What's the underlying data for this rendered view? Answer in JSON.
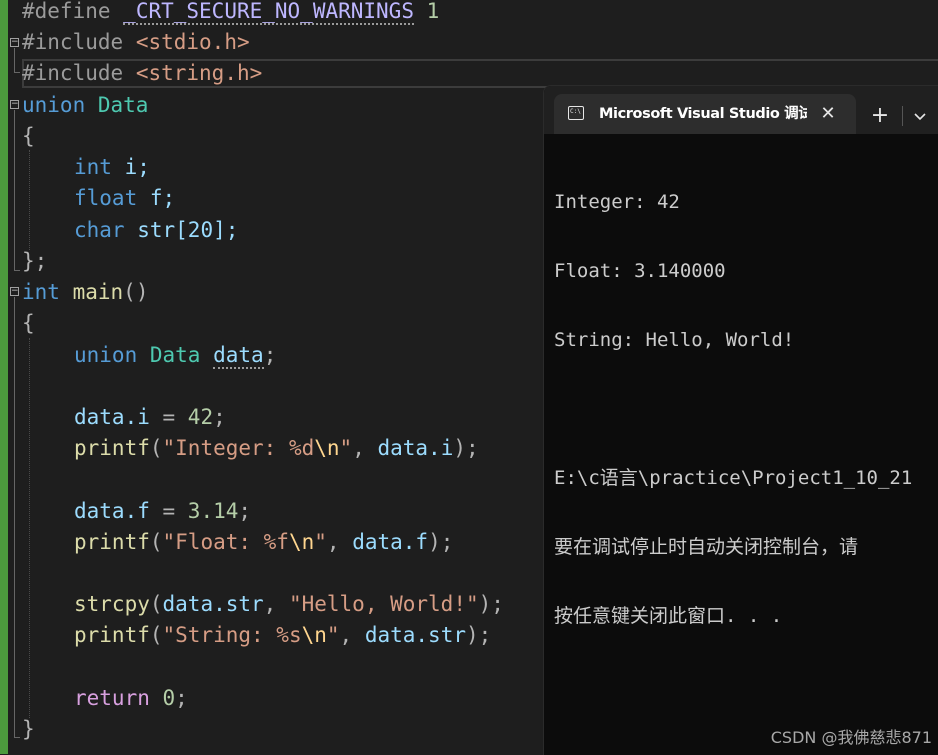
{
  "editor": {
    "lines": {
      "l1": {
        "directive": "#define",
        "macro": "_CRT_SECURE_NO_WARNINGS",
        "value": "1"
      },
      "l2": {
        "directive": "#include",
        "header": "<stdio.h>"
      },
      "l3": {
        "directive": "#include",
        "header": "<string.h>"
      },
      "l4": {
        "keyword": "union",
        "type_name": "Data"
      },
      "l5": {
        "brace": "{"
      },
      "l6": {
        "type": "int",
        "member": "i;"
      },
      "l7": {
        "type": "float",
        "member": "f;"
      },
      "l8": {
        "type": "char",
        "member": "str[20];"
      },
      "l9": {
        "brace": "};"
      },
      "l10": {
        "type": "int",
        "func": "main",
        "parens": "()"
      },
      "l11": {
        "brace": "{"
      },
      "l12": {
        "keyword": "union",
        "type_name": "Data",
        "var": "data",
        "semi": ";"
      },
      "l13": {
        "lhs": "data.i",
        "op": " = ",
        "num": "42",
        "semi": ";"
      },
      "l14": {
        "func": "printf",
        "open": "(",
        "str_a": "\"Integer: %d",
        "esc": "\\n",
        "str_b": "\"",
        "comma": ", ",
        "arg": "data.i",
        "close": ");"
      },
      "l15": {
        "lhs": "data.f",
        "op": " = ",
        "num": "3.14",
        "semi": ";"
      },
      "l16": {
        "func": "printf",
        "open": "(",
        "str_a": "\"Float: %f",
        "esc": "\\n",
        "str_b": "\"",
        "comma": ", ",
        "arg": "data.f",
        "close": ");"
      },
      "l17": {
        "func": "strcpy",
        "open": "(",
        "arg": "data.str",
        "comma": ", ",
        "str": "\"Hello, World!\"",
        "close": ");"
      },
      "l18": {
        "func": "printf",
        "open": "(",
        "str_a": "\"String: %s",
        "esc": "\\n",
        "str_b": "\"",
        "comma": ", ",
        "arg": "data.str",
        "close": ");"
      },
      "l19": {
        "keyword": "return",
        "num": "0",
        "semi": ";"
      },
      "l20": {
        "brace": "}"
      }
    }
  },
  "console": {
    "tab_title": "Microsoft Visual Studio 调试控制台",
    "icon_text": "C:\\",
    "close_glyph": "✕",
    "new_tab_glyph": "+",
    "output": [
      "Integer: 42",
      "Float: 3.140000",
      "String: Hello, World!",
      "",
      "E:\\c语言\\practice\\Project1_10_21",
      "要在调试停止时自动关闭控制台，请",
      "按任意键关闭此窗口. . ."
    ]
  },
  "watermark": "CSDN @我佛慈悲871"
}
